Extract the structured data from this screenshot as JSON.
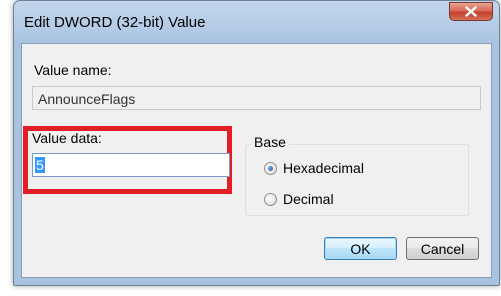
{
  "window": {
    "title": "Edit DWORD (32-bit) Value"
  },
  "value_name": {
    "label": "Value name:",
    "value": "AnnounceFlags"
  },
  "value_data": {
    "label": "Value data:",
    "value": "5"
  },
  "base": {
    "label": "Base",
    "options": [
      {
        "label": "Hexadecimal",
        "checked": true
      },
      {
        "label": "Decimal",
        "checked": false
      }
    ]
  },
  "buttons": {
    "ok": "OK",
    "cancel": "Cancel"
  },
  "colors": {
    "highlight": "#e21f26",
    "close_button": "#c2412c",
    "selection": "#3399ff"
  }
}
